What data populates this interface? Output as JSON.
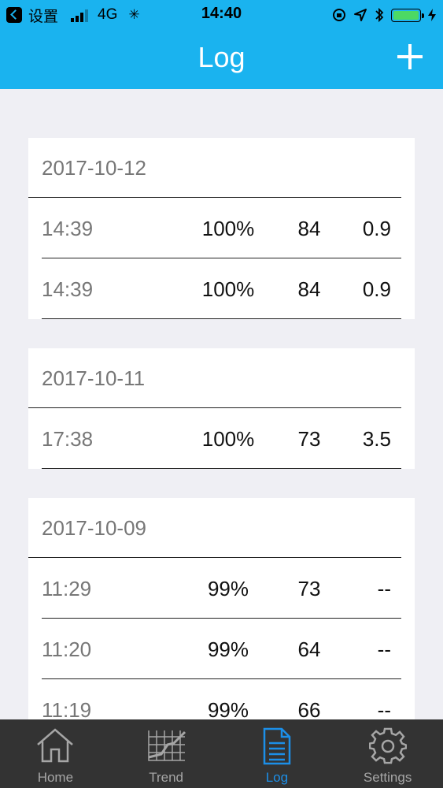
{
  "status_bar": {
    "back_app": "设置",
    "network": "4G",
    "time": "14:40"
  },
  "header": {
    "title": "Log",
    "add_icon": "plus-icon"
  },
  "colors": {
    "header_bg": "#1ab3ef",
    "tab_active": "#1c8fe8",
    "tab_inactive": "#a6a6a6",
    "tab_bar_bg": "#333333",
    "battery": "#4cd964"
  },
  "log_groups": [
    {
      "date": "2017-10-12",
      "entries": [
        {
          "time": "14:39",
          "pct": "100%",
          "value": "84",
          "extra": "0.9"
        },
        {
          "time": "14:39",
          "pct": "100%",
          "value": "84",
          "extra": "0.9"
        }
      ]
    },
    {
      "date": "2017-10-11",
      "entries": [
        {
          "time": "17:38",
          "pct": "100%",
          "value": "73",
          "extra": "3.5"
        }
      ]
    },
    {
      "date": "2017-10-09",
      "entries": [
        {
          "time": "11:29",
          "pct": "99%",
          "value": "73",
          "extra": "--"
        },
        {
          "time": "11:20",
          "pct": "99%",
          "value": "64",
          "extra": "--"
        },
        {
          "time": "11:19",
          "pct": "99%",
          "value": "66",
          "extra": "--"
        }
      ]
    }
  ],
  "tab_bar": {
    "tabs": [
      {
        "label": "Home",
        "icon": "house-icon"
      },
      {
        "label": "Trend",
        "icon": "trend-chart-icon"
      },
      {
        "label": "Log",
        "icon": "document-icon",
        "active": true
      },
      {
        "label": "Settings",
        "icon": "gear-icon"
      }
    ]
  }
}
